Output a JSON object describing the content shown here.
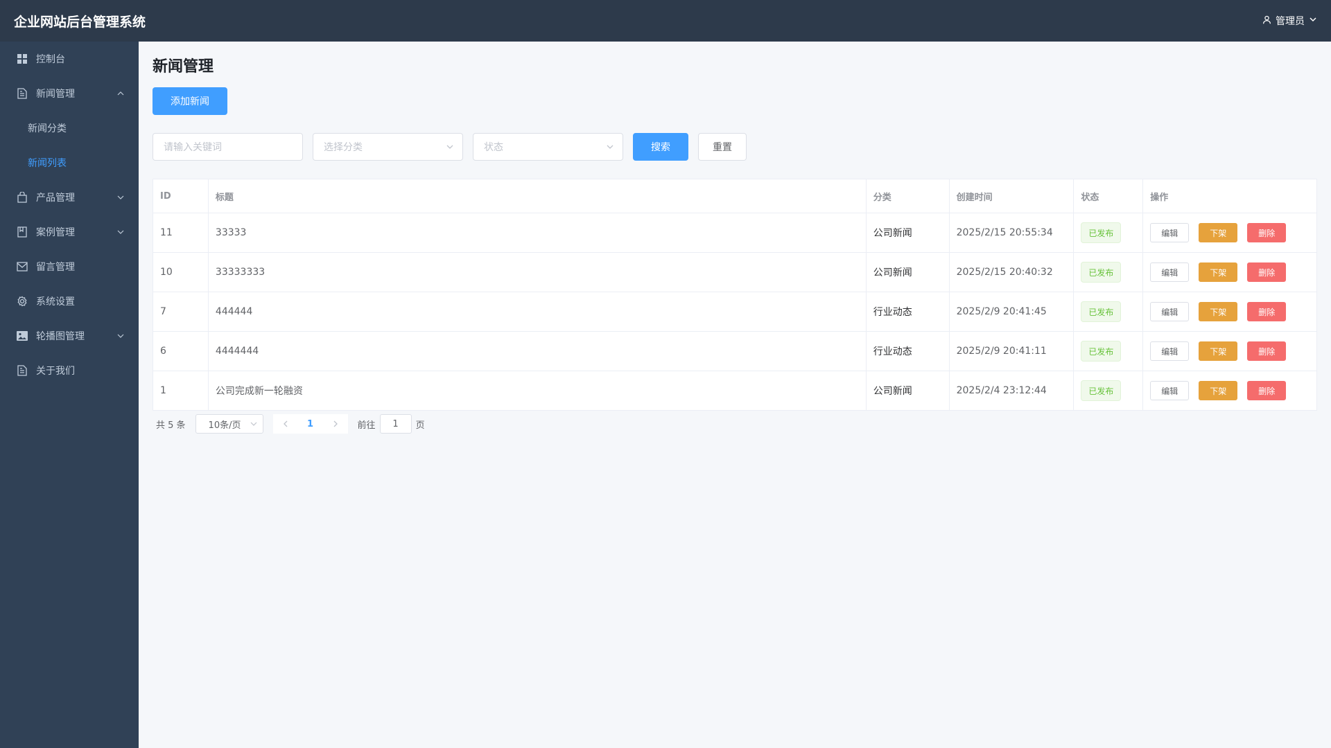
{
  "header": {
    "app_title": "企业网站后台管理系统",
    "user_label": "管理员"
  },
  "sidebar": {
    "items": [
      {
        "label": "控制台",
        "icon": "dashboard-icon"
      },
      {
        "label": "新闻管理",
        "icon": "document-icon",
        "expanded": true,
        "children": [
          {
            "label": "新闻分类",
            "active": false
          },
          {
            "label": "新闻列表",
            "active": true
          }
        ]
      },
      {
        "label": "产品管理",
        "icon": "bag-icon",
        "expandable": true
      },
      {
        "label": "案例管理",
        "icon": "notebook-icon",
        "expandable": true
      },
      {
        "label": "留言管理",
        "icon": "message-icon"
      },
      {
        "label": "系统设置",
        "icon": "gear-icon"
      },
      {
        "label": "轮播图管理",
        "icon": "picture-icon",
        "expandable": true
      },
      {
        "label": "关于我们",
        "icon": "document-icon"
      }
    ]
  },
  "main": {
    "title": "新闻管理",
    "add_button": "添加新闻",
    "filters": {
      "keyword_placeholder": "请输入关键词",
      "category_placeholder": "选择分类",
      "status_placeholder": "状态",
      "search_button": "搜索",
      "reset_button": "重置"
    },
    "table": {
      "columns": [
        "ID",
        "标题",
        "分类",
        "创建时间",
        "状态",
        "操作"
      ],
      "rows": [
        {
          "id": "11",
          "title": "33333",
          "category": "公司新闻",
          "created": "2025/2/15 20:55:34",
          "status": "已发布"
        },
        {
          "id": "10",
          "title": "33333333",
          "category": "公司新闻",
          "created": "2025/2/15 20:40:32",
          "status": "已发布"
        },
        {
          "id": "7",
          "title": "444444",
          "category": "行业动态",
          "created": "2025/2/9 20:41:45",
          "status": "已发布"
        },
        {
          "id": "6",
          "title": "4444444",
          "category": "行业动态",
          "created": "2025/2/9 20:41:11",
          "status": "已发布"
        },
        {
          "id": "1",
          "title": "公司完成新一轮融资",
          "category": "公司新闻",
          "created": "2025/2/4 23:12:44",
          "status": "已发布"
        }
      ],
      "actions": {
        "edit": "编辑",
        "unpublish": "下架",
        "delete": "删除"
      }
    },
    "pagination": {
      "total_text": "共 5 条",
      "page_size": "10条/页",
      "current_page": "1",
      "goto_label": "前往",
      "goto_value": "1",
      "page_suffix": "页"
    }
  },
  "colors": {
    "header_bg": "#2d3a4b",
    "sidebar_bg": "#304156",
    "primary": "#409eff",
    "warning": "#e6a23c",
    "danger": "#f56c6c",
    "success": "#67c23a"
  }
}
